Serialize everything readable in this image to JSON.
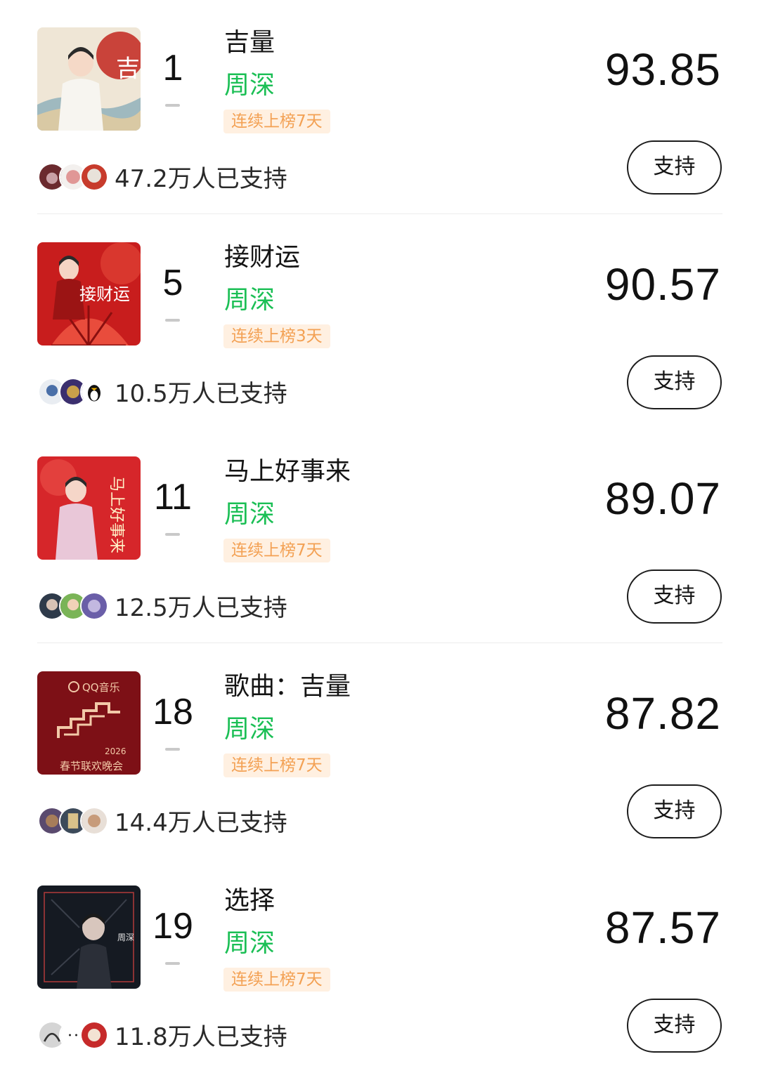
{
  "items": [
    {
      "rank": "1",
      "title": "吉量",
      "artist": "周深",
      "badge": "连续上榜7天",
      "score": "93.85",
      "supporters": "47.2万人已支持",
      "button": "支持",
      "cover_text": "吉量",
      "cover_colors": [
        "#c9433a",
        "#e8d5a8",
        "#f2eee6"
      ]
    },
    {
      "rank": "5",
      "title": "接财运",
      "artist": "周深",
      "badge": "连续上榜3天",
      "score": "90.57",
      "supporters": "10.5万人已支持",
      "button": "支持",
      "cover_text": "接财运",
      "cover_colors": [
        "#c81d1d",
        "#e94c3c",
        "#8a0f0f"
      ]
    },
    {
      "rank": "11",
      "title": "马上好事来",
      "artist": "周深",
      "badge": "连续上榜7天",
      "score": "89.07",
      "supporters": "12.5万人已支持",
      "button": "支持",
      "cover_text": "马上好事来",
      "cover_colors": [
        "#d6262a",
        "#ef5a4f",
        "#e9c7d8"
      ]
    },
    {
      "rank": "18",
      "title": "歌曲：吉量",
      "artist": "周深",
      "badge": "连续上榜7天",
      "score": "87.82",
      "supporters": "14.4万人已支持",
      "button": "支持",
      "cover_text": "QQ音乐",
      "cover_subtext": "2026",
      "cover_caption": "春节联欢晚会",
      "cover_colors": [
        "#7d1016",
        "#8f141b",
        "#f2c9a8"
      ]
    },
    {
      "rank": "19",
      "title": "选择",
      "artist": "周深",
      "badge": "连续上榜7天",
      "score": "87.57",
      "supporters": "11.8万人已支持",
      "button": "支持",
      "cover_text": "周深",
      "cover_colors": [
        "#151a22",
        "#3a3f4a",
        "#b23a3a"
      ]
    }
  ],
  "colors": {
    "artist": "#1bbf55",
    "badge_bg": "#fff0e1",
    "badge_text": "#f3a154",
    "divider": "#ececec"
  }
}
